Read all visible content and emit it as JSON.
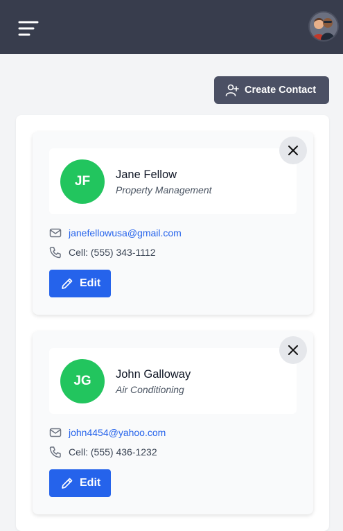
{
  "header": {
    "menu_icon": "hamburger-menu-icon",
    "avatar_icon": "user-avatar"
  },
  "toolbar": {
    "create_contact_label": "Create Contact",
    "create_contact_icon": "user-plus-icon"
  },
  "contacts": [
    {
      "initials": "JF",
      "name": "Jane Fellow",
      "company": "Property Management",
      "email": "janefellowusa@gmail.com",
      "phone": "Cell: (555) 343-1112",
      "edit_label": "Edit",
      "avatar_color": "#22c55e"
    },
    {
      "initials": "JG",
      "name": "John Galloway",
      "company": "Air Conditioning",
      "email": "john4454@yahoo.com",
      "phone": "Cell: (555) 436-1232",
      "edit_label": "Edit",
      "avatar_color": "#22c55e"
    }
  ],
  "colors": {
    "topbar": "#383d4d",
    "primary": "#2563eb",
    "create_button": "#4b5064",
    "avatar_green": "#22c55e"
  }
}
